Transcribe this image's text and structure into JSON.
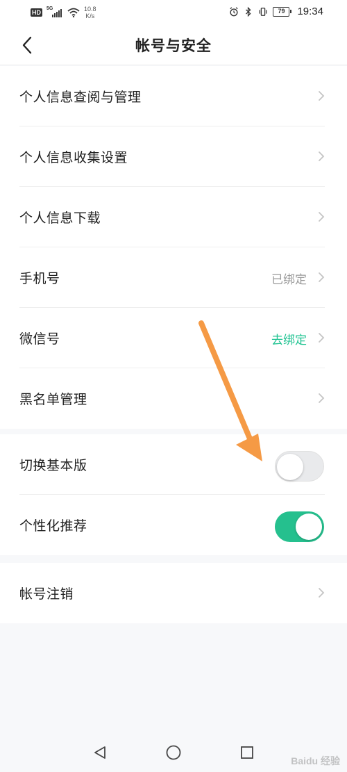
{
  "status_bar": {
    "hd": "HD",
    "signal": "5G",
    "speed_value": "10.8",
    "speed_unit": "K/s",
    "battery": "79",
    "time": "19:34"
  },
  "header": {
    "title": "帐号与安全",
    "back_icon": "back-chevron-icon"
  },
  "sections": {
    "personal_info_view": {
      "label": "个人信息查阅与管理"
    },
    "personal_info_collect": {
      "label": "个人信息收集设置"
    },
    "personal_info_download": {
      "label": "个人信息下载"
    },
    "phone": {
      "label": "手机号",
      "value": "已绑定"
    },
    "wechat": {
      "label": "微信号",
      "value": "去绑定"
    },
    "blacklist": {
      "label": "黑名单管理"
    },
    "basic_mode": {
      "label": "切换基本版",
      "enabled": false
    },
    "personalized": {
      "label": "个性化推荐",
      "enabled": true
    },
    "deregister": {
      "label": "帐号注销"
    }
  },
  "colors": {
    "accent_green": "#25c08e",
    "link_green": "#1ec391",
    "annotation_arrow": "#f59a45"
  },
  "navigation": {
    "back": "triangle-back-icon",
    "home": "circle-home-icon",
    "recents": "square-recents-icon"
  },
  "watermark": "Baidu 经验"
}
